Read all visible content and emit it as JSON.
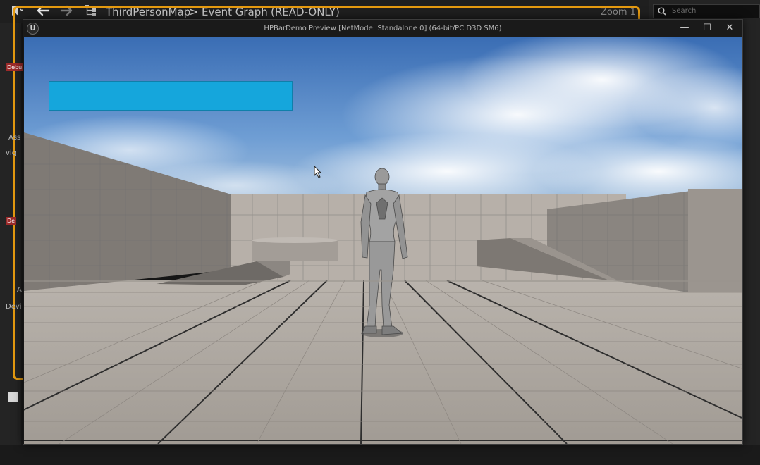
{
  "editor": {
    "breadcrumb": {
      "map": "ThirdPersonMap",
      "separator": ">",
      "graph": "Event Graph",
      "mode": "(READ-ONLY)"
    },
    "zoom": "Zoom 1",
    "search": {
      "placeholder": "Search"
    },
    "fragments": {
      "a1": "Ass",
      "a2": "vig",
      "a3": "A",
      "a4": "Devi",
      "tag1": "Debu",
      "tag2": "De"
    }
  },
  "pie": {
    "title": "HPBarDemo Preview [NetMode: Standalone 0]  (64-bit/PC D3D SM6)",
    "logo": "U",
    "controls": {
      "minimize": "—",
      "maximize": "☐",
      "close": "✕"
    }
  },
  "colors": {
    "accent_orange": "#e59a10",
    "hp_bar": "#15a6dc",
    "sky_top": "#3d6fb6",
    "floor": "#a9a39c"
  },
  "icons": {
    "bookmark": "bookmark-icon",
    "back": "arrow-left-icon",
    "forward": "arrow-right-icon",
    "hierarchy": "hierarchy-icon",
    "search": "search-icon"
  }
}
